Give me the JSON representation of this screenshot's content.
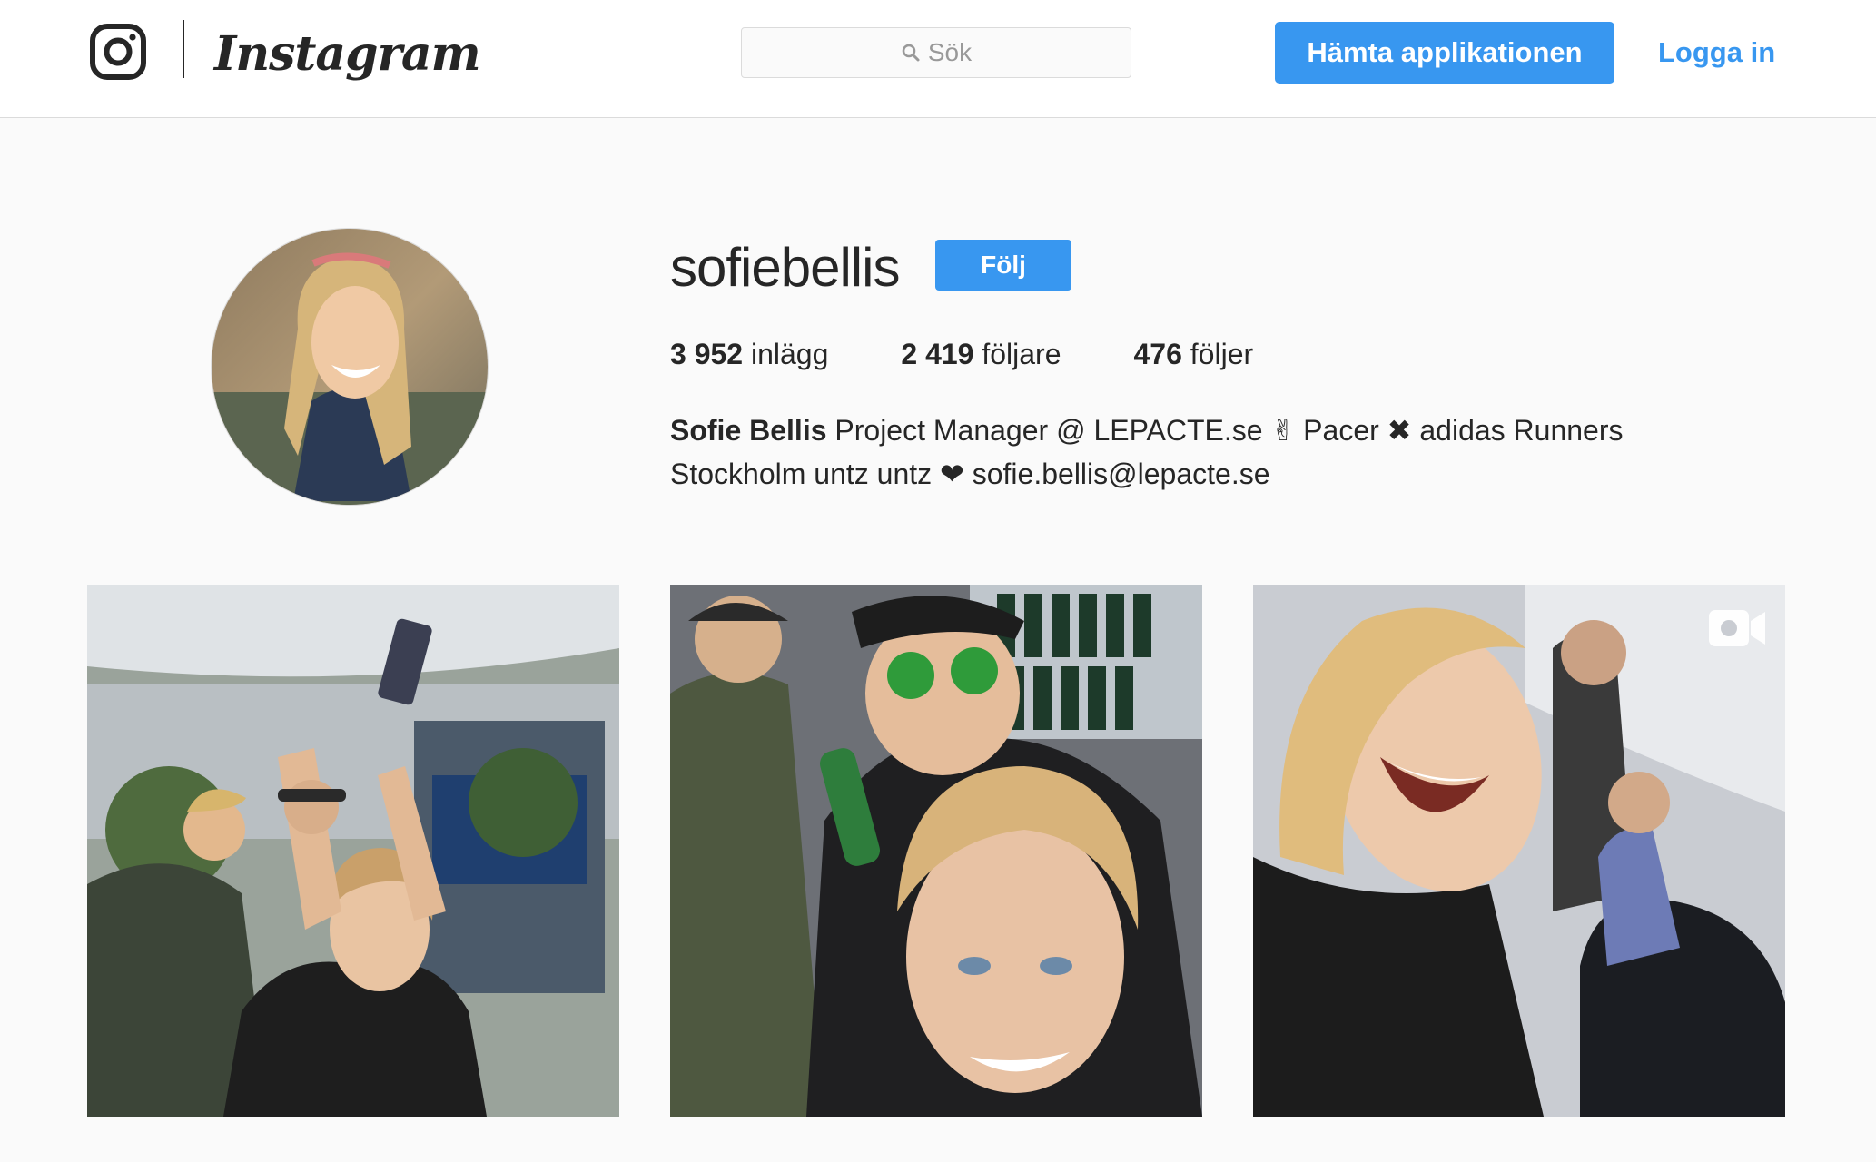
{
  "header": {
    "wordmark": "Instagram",
    "search_placeholder": "Sök",
    "get_app_label": "Hämta applikationen",
    "login_label": "Logga in"
  },
  "profile": {
    "username": "sofiebellis",
    "follow_label": "Följ",
    "stats": [
      {
        "count": "3 952",
        "label": "inlägg"
      },
      {
        "count": "2 419",
        "label": "följare"
      },
      {
        "count": "476",
        "label": "följer"
      }
    ],
    "bio_name": "Sofie Bellis",
    "bio_line1_text": " Project Manager @ LEPACTE.se ✌ Pacer ✖ adidas Runners",
    "bio_line2_text": "Stockholm untz untz ❤ sofie.bellis@lepacte.se"
  },
  "posts": [
    {
      "type": "photo",
      "icon": null
    },
    {
      "type": "photo",
      "icon": null
    },
    {
      "type": "video",
      "icon": "video-camera-icon"
    }
  ],
  "colors": {
    "accent": "#3897f0",
    "background": "#fafafa",
    "text": "#262626",
    "border": "#dbdbdb"
  }
}
